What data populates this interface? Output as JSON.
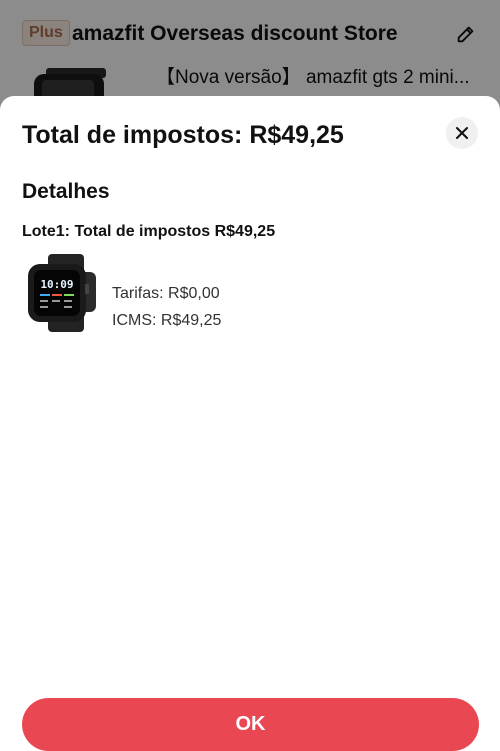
{
  "background": {
    "plus_badge": "Plus",
    "store_name": "amazfit Overseas discount Store",
    "product_title": "【Nova versão】 amazfit gts 2 mini..."
  },
  "sheet": {
    "title": "Total de impostos: R$49,25",
    "section_title": "Detalhes",
    "lot_title": "Lote1: Total de impostos R$49,25",
    "tax_lines": [
      "Tarifas: R$0,00",
      "ICMS: R$49,25"
    ],
    "ok_label": "OK"
  },
  "watch_face": {
    "time": "10:09"
  },
  "colors": {
    "accent": "#e94852",
    "overlay": "rgba(0,0,0,0.45)"
  },
  "icons": {
    "edit": "pencil-icon",
    "close": "close-icon"
  }
}
